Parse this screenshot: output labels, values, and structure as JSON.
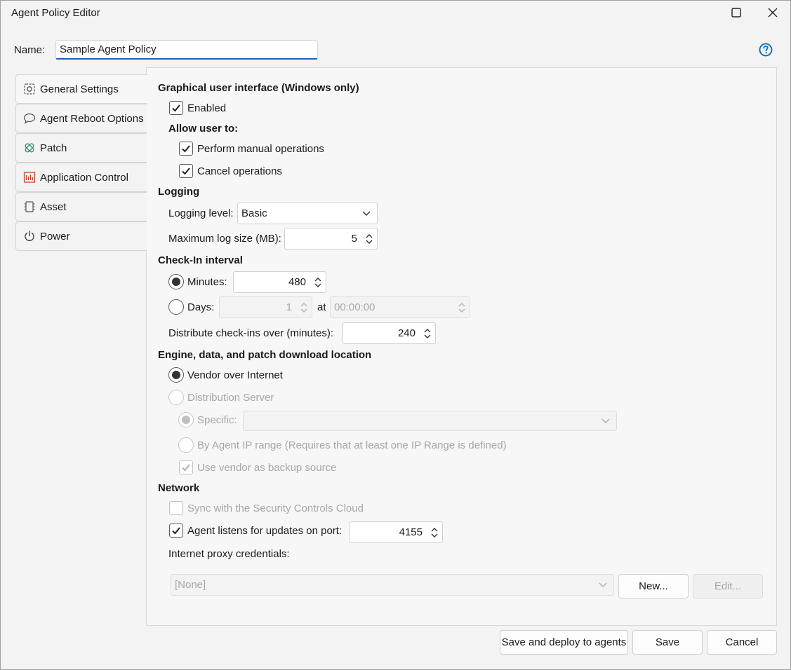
{
  "window": {
    "title": "Agent Policy Editor"
  },
  "name_field": {
    "label": "Name:",
    "value": "Sample Agent Policy"
  },
  "tabs": [
    {
      "label": "General Settings",
      "icon": "gear-icon"
    },
    {
      "label": "Agent Reboot Options",
      "icon": "speech-bubble-icon"
    },
    {
      "label": "Patch",
      "icon": "bandage-icon"
    },
    {
      "label": "Application Control",
      "icon": "app-control-icon"
    },
    {
      "label": "Asset",
      "icon": "chip-icon"
    },
    {
      "label": "Power",
      "icon": "power-icon"
    }
  ],
  "gui": {
    "heading": "Graphical user interface (Windows only)",
    "enabled_label": "Enabled",
    "allow_heading": "Allow user to:",
    "manual_label": "Perform manual operations",
    "cancel_label": "Cancel operations"
  },
  "logging": {
    "heading": "Logging",
    "level_label": "Logging level:",
    "level_value": "Basic",
    "max_size_label": "Maximum log size (MB):",
    "max_size_value": "5"
  },
  "checkin": {
    "heading": "Check-In interval",
    "minutes_label": "Minutes:",
    "minutes_value": "480",
    "days_label": "Days:",
    "days_value": "1",
    "at_label": "at",
    "time_value": "00:00:00",
    "distribute_label": "Distribute check-ins over (minutes):",
    "distribute_value": "240"
  },
  "download": {
    "heading": "Engine, data, and patch download location",
    "vendor_label": "Vendor over Internet",
    "distribution_label": "Distribution Server",
    "specific_label": "Specific:",
    "by_ip_label": "By Agent IP range (Requires that at least one IP Range is defined)",
    "backup_label": "Use vendor as backup source"
  },
  "network": {
    "heading": "Network",
    "sync_label": "Sync with the Security Controls Cloud",
    "listen_label": "Agent listens for updates on port:",
    "port_value": "4155",
    "proxy_label": "Internet proxy credentials:",
    "proxy_value": "[None]",
    "new_label": "New...",
    "edit_label": "Edit..."
  },
  "footer": {
    "deploy_label": "Save and deploy to agents",
    "save_label": "Save",
    "cancel_label": "Cancel"
  },
  "colors": {
    "accent": "#1d5fbf",
    "help": "#0067c0"
  }
}
